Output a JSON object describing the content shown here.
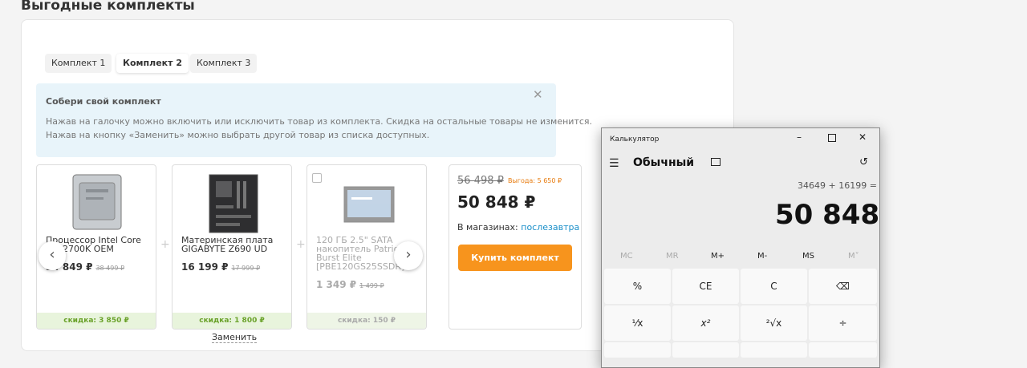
{
  "page_title": "Выгодные комплекты",
  "tabs": [
    {
      "label": "Комплект 1"
    },
    {
      "label": "Комплект 2"
    },
    {
      "label": "Комплект 3"
    }
  ],
  "info": {
    "title": "Собери свой комплект",
    "line1": "Нажав на галочку можно включить или исключить товар из комплекта. Скидка на остальные товары не изменится.",
    "line2": "Нажав на кнопку «Заменить» можно выбрать другой товар из списка доступных.",
    "close": "✕"
  },
  "products": [
    {
      "name1": "Процессор Intel Core",
      "name2": "i7-12700K OEM",
      "price": "34 849 ₽",
      "old": "38 499 ₽",
      "discount": "скидка: 3 850 ₽"
    },
    {
      "name1": "Материнская плата",
      "name2": "GIGABYTE Z690 UD",
      "price": "16 199 ₽",
      "old": "17 999 ₽",
      "discount": "скидка: 1 800 ₽"
    },
    {
      "name1": "120 ГБ 2.5\" SATA",
      "name2": "накопитель Patriot",
      "name3": "Burst Elite",
      "name4": "[PBE120GS25SSDR]",
      "price": "1 349 ₽",
      "old": "1 499 ₽",
      "discount": "скидка: 150 ₽"
    }
  ],
  "plus": "+",
  "replace_label": "Заменить",
  "total": {
    "old_price": "56 498 ₽",
    "savings": "Выгода: 5 650 ₽",
    "price": "50 848 ₽",
    "stores_label": "В магазинах:",
    "stores_value": "послезавтра",
    "buy_label": "Купить комплект"
  },
  "calculator": {
    "title": "Калькулятор",
    "mode": "Обычный",
    "expression": "34649 + 16199 =",
    "result": "50 848",
    "memory": [
      "MC",
      "MR",
      "M+",
      "M-",
      "MS",
      "M˅"
    ],
    "keys_row1": [
      "%",
      "CE",
      "C",
      "⌫"
    ],
    "keys_row2": [
      "¹⁄x",
      "x²",
      "²√x",
      "÷"
    ]
  },
  "colors": {
    "accent": "#f7941d",
    "link": "#1a8fc9",
    "discount": "#6aa22a",
    "savings": "#e77b0e"
  }
}
